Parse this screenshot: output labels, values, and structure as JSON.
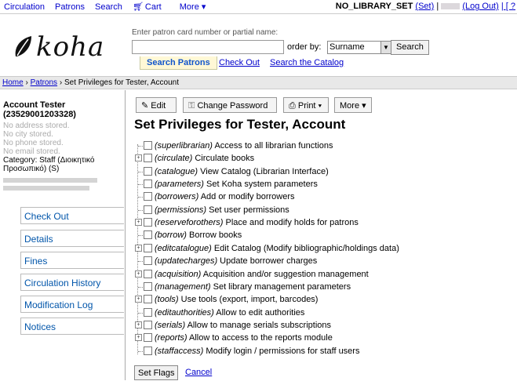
{
  "topnav": {
    "items": [
      "Circulation",
      "Patrons",
      "Search"
    ],
    "cart": "Cart",
    "more": "More ▾"
  },
  "login": {
    "library": "NO_LIBRARY_SET",
    "set": "(Set)",
    "sep": "|",
    "logout": "(Log Out)",
    "help": "| [ ?"
  },
  "logo": {
    "text": "koha"
  },
  "search": {
    "hint": "Enter patron card number or partial name:",
    "orderby_label": "order by:",
    "orderby_value": "Surname",
    "button": "Search",
    "tabs": [
      "Search Patrons",
      "Check Out",
      "Search the Catalog"
    ]
  },
  "breadcrumbs": {
    "home": "Home",
    "sep1": "›",
    "patrons": "Patrons",
    "sep2": "›",
    "current": "Set Privileges for Tester, Account"
  },
  "patron": {
    "name": "Account Tester",
    "card": "(23529001203328)",
    "address": "No address stored.",
    "city": "No city stored.",
    "phone": "No phone stored.",
    "email": "No email stored.",
    "category": "Category: Staff (Διοικητικό Προσωπικό) (S)"
  },
  "menu": [
    "Check Out",
    "Details",
    "Fines",
    "Circulation History",
    "Modification Log",
    "Notices"
  ],
  "toolbar": {
    "edit": "Edit",
    "change_password": "Change Password",
    "print": "Print ▾",
    "more": "More ▾"
  },
  "page_title": "Set Privileges for Tester, Account",
  "permissions": [
    {
      "code": "(superlibrarian)",
      "desc": "Access to all librarian functions",
      "expandable": false
    },
    {
      "code": "(circulate)",
      "desc": "Circulate books",
      "expandable": true
    },
    {
      "code": "(catalogue)",
      "desc": "View Catalog (Librarian Interface)",
      "expandable": false
    },
    {
      "code": "(parameters)",
      "desc": "Set Koha system parameters",
      "expandable": false
    },
    {
      "code": "(borrowers)",
      "desc": "Add or modify borrowers",
      "expandable": false
    },
    {
      "code": "(permissions)",
      "desc": "Set user permissions",
      "expandable": false
    },
    {
      "code": "(reserveforothers)",
      "desc": "Place and modify holds for patrons",
      "expandable": true
    },
    {
      "code": "(borrow)",
      "desc": "Borrow books",
      "expandable": false
    },
    {
      "code": "(editcatalogue)",
      "desc": "Edit Catalog (Modify bibliographic/holdings data)",
      "expandable": true
    },
    {
      "code": "(updatecharges)",
      "desc": "Update borrower charges",
      "expandable": false
    },
    {
      "code": "(acquisition)",
      "desc": "Acquisition and/or suggestion management",
      "expandable": true
    },
    {
      "code": "(management)",
      "desc": "Set library management parameters",
      "expandable": false
    },
    {
      "code": "(tools)",
      "desc": "Use tools (export, import, barcodes)",
      "expandable": true
    },
    {
      "code": "(editauthorities)",
      "desc": "Allow to edit authorities",
      "expandable": false
    },
    {
      "code": "(serials)",
      "desc": "Allow to manage serials subscriptions",
      "expandable": true
    },
    {
      "code": "(reports)",
      "desc": "Allow to access to the reports module",
      "expandable": true
    },
    {
      "code": "(staffaccess)",
      "desc": "Modify login / permissions for staff users",
      "expandable": false
    }
  ],
  "actions": {
    "set_flags": "Set Flags",
    "cancel": "Cancel"
  }
}
